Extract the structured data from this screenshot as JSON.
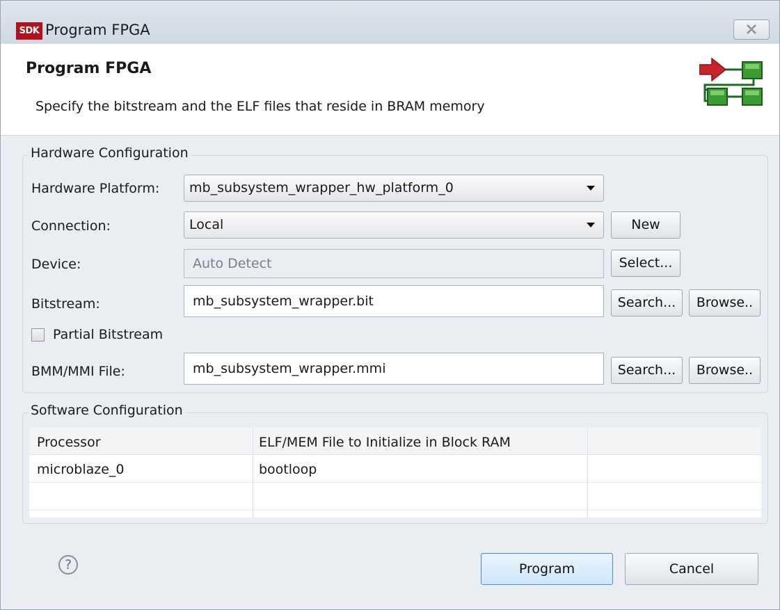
{
  "window": {
    "icon_text": "SDK",
    "title": "Program FPGA"
  },
  "header": {
    "title": "Program FPGA",
    "description": "Specify the bitstream and the ELF files that reside in BRAM memory"
  },
  "hardware": {
    "group_label": "Hardware Configuration",
    "platform_label": "Hardware Platform:",
    "platform_value": "mb_subsystem_wrapper_hw_platform_0",
    "connection_label": "Connection:",
    "connection_value": "Local",
    "new_button": "New",
    "device_label": "Device:",
    "device_value": "Auto Detect",
    "select_button": "Select...",
    "bitstream_label": "Bitstream:",
    "bitstream_value": "mb_subsystem_wrapper.bit",
    "search_button": "Search...",
    "browse_button": "Browse..",
    "partial_label": "Partial Bitstream",
    "partial_checked": false,
    "bmm_label": "BMM/MMI File:",
    "bmm_value": "mb_subsystem_wrapper.mmi"
  },
  "software": {
    "group_label": "Software Configuration",
    "columns": [
      "Processor",
      "ELF/MEM File to Initialize in Block RAM",
      ""
    ],
    "rows": [
      [
        "microblaze_0",
        "bootloop",
        ""
      ]
    ]
  },
  "footer": {
    "help_symbol": "?",
    "program_button": "Program",
    "cancel_button": "Cancel"
  },
  "colors": {
    "sdk_icon": "#b3121c",
    "arrow_red": "#c8252b",
    "block_green": "#3e9b31",
    "default_button_border": "#4a8fd6"
  }
}
